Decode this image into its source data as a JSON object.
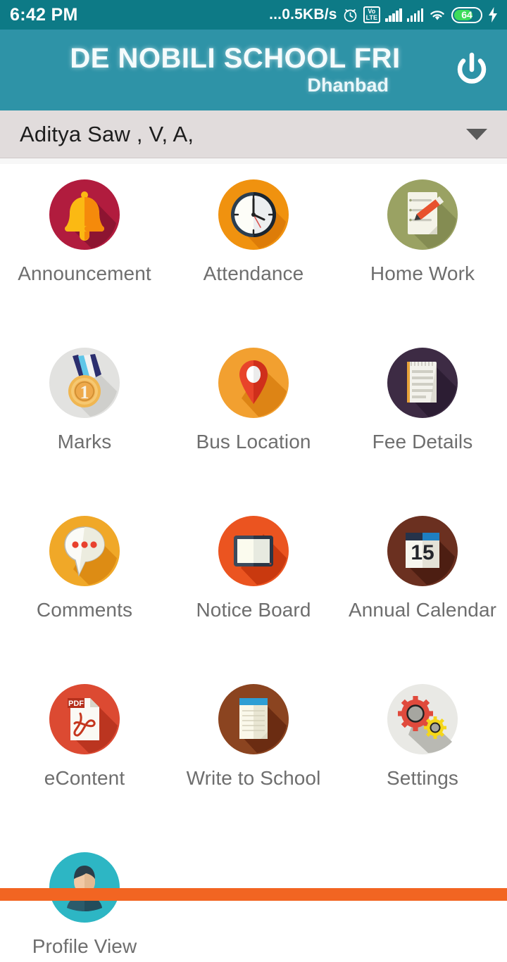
{
  "status_bar": {
    "time": "6:42 PM",
    "network_speed": "0.5KB/s",
    "speed_prefix": "...",
    "battery_level": "64",
    "icons": [
      "alarm-icon",
      "volte-icon",
      "signal-bars-icon",
      "signal-bars-icon",
      "wifi-icon",
      "battery-icon",
      "charging-bolt-icon"
    ],
    "volte_top": "Vo",
    "volte_bottom": "LTE",
    "background_color": "#0d7a86"
  },
  "header": {
    "title": "DE NOBILI SCHOOL FRI",
    "subtitle": "Dhanbad",
    "logout_icon": "power-icon",
    "background_color": "#2e93a7"
  },
  "student_selector": {
    "selected": "Aditya Saw , V, A,",
    "caret_icon": "chevron-down-icon",
    "background_color": "#e1dcdc"
  },
  "menu": {
    "items": [
      {
        "label": "Announcement",
        "icon": "bell-icon",
        "circle_color": "#b11c3e"
      },
      {
        "label": "Attendance",
        "icon": "clock-icon",
        "circle_color": "#f0920f"
      },
      {
        "label": "Home Work",
        "icon": "document-pencil-icon",
        "circle_color": "#9aa263"
      },
      {
        "label": "Marks",
        "icon": "medal-icon",
        "circle_color": "#e2e2e0"
      },
      {
        "label": "Bus Location",
        "icon": "map-pin-icon",
        "circle_color": "#f2a030"
      },
      {
        "label": "Fee Details",
        "icon": "notepad-icon",
        "circle_color": "#3d2b44"
      },
      {
        "label": "Comments",
        "icon": "speech-bubble-icon",
        "circle_color": "#f0a828"
      },
      {
        "label": "Notice Board",
        "icon": "board-icon",
        "circle_color": "#eb5420"
      },
      {
        "label": "Annual Calendar",
        "icon": "calendar-icon",
        "circle_color": "#6b3020"
      },
      {
        "label": "eContent",
        "icon": "pdf-icon",
        "circle_color": "#dc4a32"
      },
      {
        "label": "Write to School",
        "icon": "notebook-icon",
        "circle_color": "#8b4420"
      },
      {
        "label": "Settings",
        "icon": "gears-icon",
        "circle_color": "#e4e4e2"
      },
      {
        "label": "Profile View",
        "icon": "person-icon",
        "circle_color": "#2db6c4"
      }
    ],
    "calendar_day": "15",
    "pdf_label": "PDF",
    "medal_number": "1"
  },
  "bottom_bar": {
    "color": "#f26522"
  }
}
